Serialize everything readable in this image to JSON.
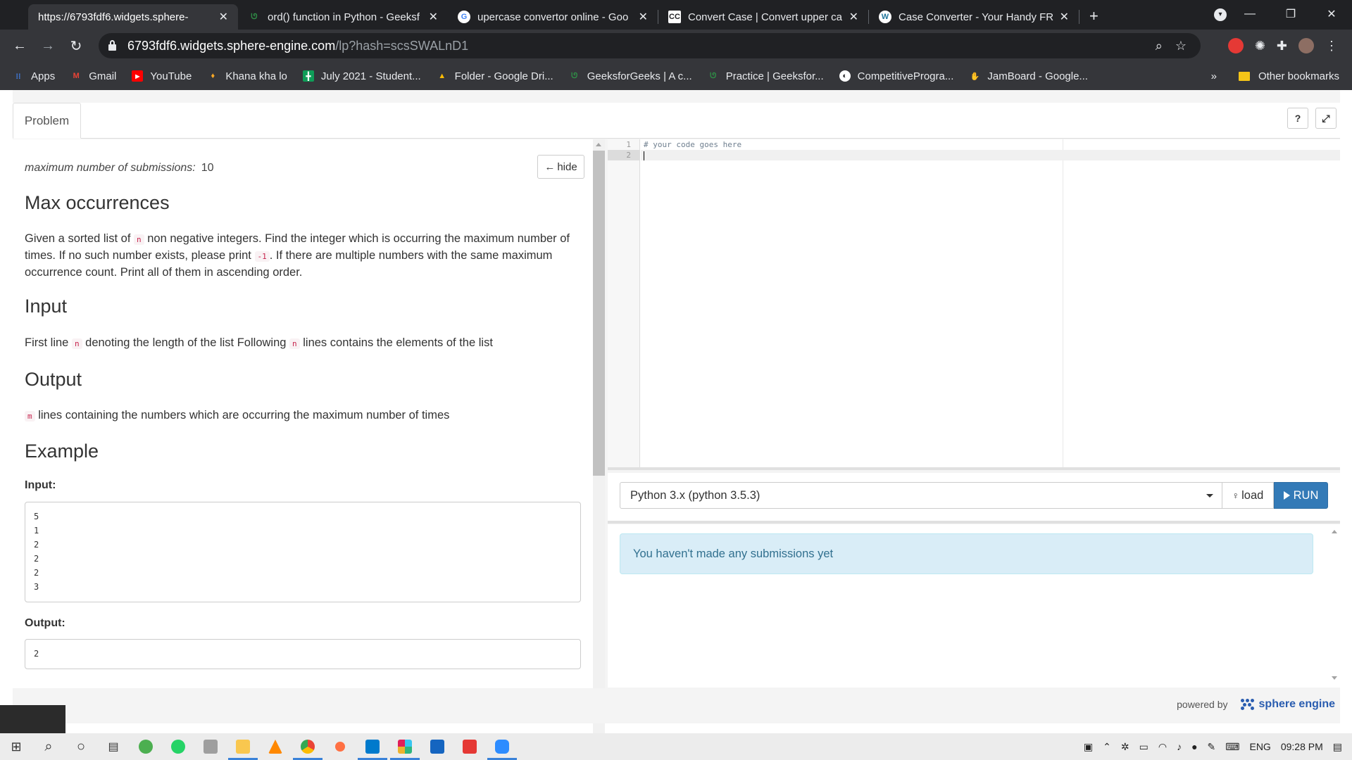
{
  "browser": {
    "tabs": [
      {
        "title": "https://6793fdf6.widgets.sphere-",
        "icon": "none",
        "active": true
      },
      {
        "title": "ord() function in Python - Geeksf",
        "icon": "gfg-icon",
        "active": false
      },
      {
        "title": "upercase convertor online - Goo",
        "icon": "google-icon",
        "active": false
      },
      {
        "title": "Convert Case | Convert upper ca",
        "icon": "cc-icon",
        "active": false
      },
      {
        "title": "Case Converter - Your Handy FRE",
        "icon": "wordpress-icon",
        "active": false
      }
    ],
    "cc_label": "CC",
    "address": {
      "host": "6793fdf6.widgets.sphere-engine.com",
      "path": "/lp?hash=scsSWALnD1"
    },
    "bookmarks": [
      {
        "label": "Apps",
        "color": "#4285f4"
      },
      {
        "label": "Gmail",
        "color": "#ea4335"
      },
      {
        "label": "YouTube",
        "color": "#ff0000"
      },
      {
        "label": "Khana kha lo",
        "color": "#f9a825"
      },
      {
        "label": "July 2021 - Student...",
        "color": "#0f9d58"
      },
      {
        "label": "Folder - Google Dri...",
        "color": "#fbbc04"
      },
      {
        "label": "GeeksforGeeks | A c...",
        "color": "#2f8d46"
      },
      {
        "label": "Practice | Geeksfor...",
        "color": "#2f8d46"
      },
      {
        "label": "CompetitiveProgra...",
        "color": "#ffffff"
      },
      {
        "label": "JamBoard - Google...",
        "color": "#fbbc04"
      }
    ],
    "bookmarks_more": "»",
    "other_bookmarks": "Other bookmarks"
  },
  "tabs_row": {
    "problem_tab": "Problem",
    "help": "?",
    "expand": "⤢"
  },
  "problem": {
    "max_submissions_label": "maximum number of submissions:",
    "max_submissions_value": "10",
    "hide_label": "hide",
    "title": "Max occurrences",
    "desc": {
      "p1": "Given a sorted list of",
      "n": "n",
      "p2": "non negative integers. Find the integer which is occurring the maximum number of times. If no such number exists, please print",
      "neg": "-1",
      "p3": ". If there are multiple numbers with the same maximum occurrence count. Print all of them in ascending order."
    },
    "input_heading": "Input",
    "input_text": {
      "a": "First line",
      "n": "n",
      "b": "denoting the length of the list Following",
      "c": "lines contains the elements of the list"
    },
    "output_heading": "Output",
    "output_text": {
      "m": "m",
      "b": "lines containing the numbers which are occurring the maximum number of times"
    },
    "example_heading": "Example",
    "example_input_label": "Input:",
    "example_input_lines": [
      "5",
      "1",
      "2",
      "2",
      "2",
      "3"
    ],
    "example_output_label": "Output:",
    "example_output_lines": [
      "2"
    ]
  },
  "editor": {
    "line_numbers": [
      "1",
      "2"
    ],
    "lines": [
      "# your code goes here",
      ""
    ]
  },
  "controls": {
    "language": "Python 3.x (python 3.5.3)",
    "load_label": "load",
    "run_label": "RUN"
  },
  "results": {
    "message": "You haven't made any submissions yet"
  },
  "footer": {
    "powered_by": "powered by",
    "brand": "sphere engine"
  },
  "taskbar": {
    "language": "ENG",
    "time": "09:28 PM"
  },
  "colors": {
    "run_button": "#337ab7",
    "alert_bg": "#d9edf7",
    "alert_text": "#31708f",
    "keyword": "#c7254e"
  }
}
